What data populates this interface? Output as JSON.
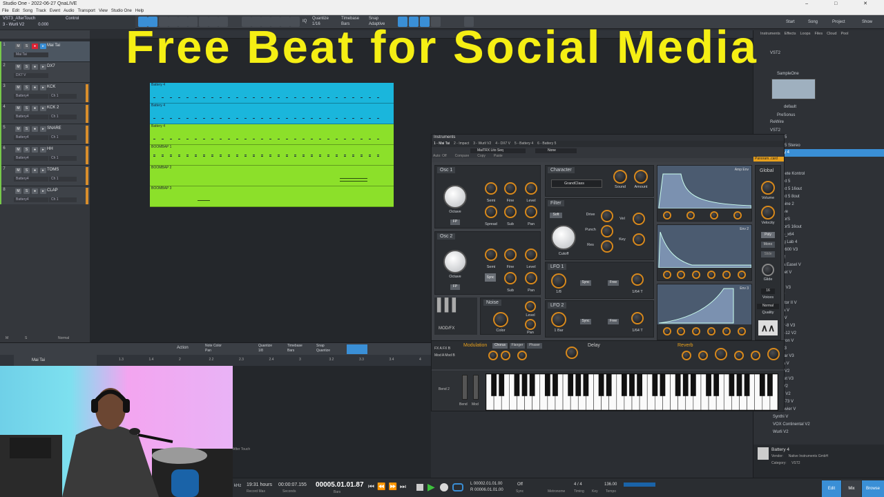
{
  "window": {
    "title": "Studio One - 2022-06-27 QnaLIVE",
    "controls": "–  □  ✕"
  },
  "menu": [
    "File",
    "Edit",
    "Song",
    "Track",
    "Event",
    "Audio",
    "Transport",
    "View",
    "Studio One",
    "Help"
  ],
  "song": {
    "name": "VST3_AfterTouch",
    "track": "3 - Wurli V2",
    "value": "0.000",
    "control_label": "Control"
  },
  "toolbar": {
    "quantize_label": "Quantize",
    "quantize": "1/16",
    "timebase_label": "Timebase",
    "timebase": "Bars",
    "snap_label": "Snap",
    "snap": "Adaptive",
    "iq": "IQ"
  },
  "right_nav": {
    "start": "Start",
    "song": "Song",
    "project": "Project",
    "show": "Show"
  },
  "ruler": [
    "9",
    "10"
  ],
  "overlay_title": "Free Beat for Social Media",
  "tracks": [
    {
      "num": "1",
      "name": "Mai Tai",
      "sel": "Mai Tai",
      "sel2": ""
    },
    {
      "num": "2",
      "name": "DX7",
      "sel": "DX7 V",
      "sel2": ""
    },
    {
      "num": "3",
      "name": "KCK",
      "sel": "Battery4",
      "sel2": "Ch 1"
    },
    {
      "num": "4",
      "name": "KCK 2",
      "sel": "Battery4",
      "sel2": "Ch 1"
    },
    {
      "num": "5",
      "name": "SNARE",
      "sel": "Battery4",
      "sel2": "Ch 1"
    },
    {
      "num": "6",
      "name": "HH",
      "sel": "Battery4",
      "sel2": "Ch 1"
    },
    {
      "num": "7",
      "name": "TOMS",
      "sel": "Battery4",
      "sel2": "Ch 1"
    },
    {
      "num": "8",
      "name": "CLAP",
      "sel": "Battery4",
      "sel2": "Ch 1"
    }
  ],
  "clips": [
    {
      "label": "Battery 4",
      "color": "blue"
    },
    {
      "label": "Battery 4",
      "color": "blue"
    },
    {
      "label": "Battery 4",
      "color": "green"
    },
    {
      "label": "BOOMBAP 1",
      "color": "green"
    },
    {
      "label": "BOOMBAP 2",
      "color": "green"
    },
    {
      "label": "BOOMBAP 3",
      "color": "green"
    }
  ],
  "browser": {
    "tabs": [
      "Instruments",
      "Effects",
      "Loops",
      "Files",
      "Cloud",
      "Pool"
    ],
    "items": [
      "VST2",
      "SampleOne",
      "default",
      "PreSonus",
      "ReWire",
      "VST2",
      "Synth 5",
      "Synth 5 Stereo",
      "Battery 4",
      "D2",
      "B3",
      "Complete Kontrol",
      "Kontakt 5",
      "Kontakt 5 16out",
      "Kontakt 5 8out",
      "Maschine 2",
      "Massive",
      "ReaktorS",
      "ReaktorS 16out",
      "Serum_x64",
      "Analog Lab 4",
      "ARP 2600 V3",
      "B-3 V2",
      "Buchla Easel V",
      "Clavinet V",
      "CMI V",
      "CS-80 V3",
      "DX7 V",
      "Emulator II V",
      "Farfisa V",
      "Jun-6 V",
      "Jupiter-8 V3",
      "Matrix-12 V2",
      "Mellotron V",
      "Mini V3",
      "Modular V3",
      "OB-Xa V",
      "Piano V2",
      "Prophet V3",
      "SEM V2",
      "Solina V2",
      "Stage-73 V",
      "Synclavier V",
      "Synthi V",
      "VOX Continental V2",
      "Wurli V2"
    ],
    "selected": "Battery 4",
    "footer": {
      "name": "Battery 4",
      "vendor_label": "Vendor:",
      "vendor": "Native Instruments GmbH",
      "cat_label": "Category:",
      "cat": "VST2"
    }
  },
  "instrument": {
    "title": "Instruments",
    "tabs": [
      "1 - Mai Tai",
      "2 - Impact",
      "3 - Wurli V2",
      "4 - DX7 V",
      "5 - Battery 4",
      "6 - Battery 5"
    ],
    "preset": "MaiTRX Lito Seq",
    "none": "None",
    "preset_right": "Panoram..card",
    "sub": [
      "Auto: Off",
      "Compare",
      "Copy",
      "Paste"
    ],
    "osc1": "Osc 1",
    "osc2": "Osc 2",
    "character": "Character",
    "filter": "Filter",
    "lfo1": "LFO 1",
    "lfo2": "LFO 2",
    "noise": "Noise",
    "global": "Global",
    "grandclass": "GrandClass",
    "knobs": {
      "octave": "Octave",
      "semi": "Semi",
      "fine": "Fine",
      "level": "Level",
      "spread": "Spread",
      "sub": "Sub",
      "pan": "Pan",
      "sound": "Sound",
      "amount": "Amount",
      "drive": "Drive",
      "punch": "Punch",
      "res": "Res",
      "cutoff": "Cutoff",
      "vel": "Vel",
      "key": "Key",
      "color": "Color",
      "volume": "Volume",
      "velocity": "Velocity",
      "glide": "Glide",
      "voices": "Voices",
      "quality": "Quality"
    },
    "fp": "FP",
    "sync": "Sync",
    "soft": "Soft",
    "free": "Free",
    "rate1": "1/8",
    "rate1r": "1/64 T",
    "rate2": "1 Bar",
    "rate2r": "1/64 T",
    "env": [
      "Amp Env",
      "Env 2",
      "Env 3"
    ],
    "poly": "Poly",
    "mono": "Mono",
    "legato": "Slide",
    "voices_val": "16",
    "quality_val": "Normal",
    "modfx": "MOD/FX",
    "modulation": "Modulation",
    "chorus": "Chorus",
    "flanger": "Flanger",
    "phaser": "Phaser",
    "delay": "Delay",
    "reverb": "Reverb",
    "mod_knobs": [
      "Mono",
      "Delay",
      "Speed",
      "Width",
      "Depth"
    ],
    "rev_knobs": [
      "Pre",
      "Damp",
      "Size",
      "Low",
      "High",
      "Mix"
    ],
    "bend": "Bend",
    "mod": "Mod",
    "bend2": "Bend 2"
  },
  "editor": {
    "track": "Mai Tai",
    "action": "Action",
    "note_color_label": "Note Color",
    "note_color": "Pan",
    "quantize_label": "Quantize",
    "quantize": "1/8",
    "timebase_label": "Timebase",
    "timebase": "Bars",
    "snap_label": "Snap",
    "snap": "Quantize",
    "ruler": [
      "1.3",
      "1.4",
      "2",
      "2.2",
      "2.3",
      "2.4",
      "3",
      "3.2",
      "3.3",
      "3.4",
      "4"
    ],
    "normal": "Normal"
  },
  "transport": {
    "rate": "kHz",
    "record_hours": "19:31 hours",
    "record_label": "Record Max",
    "seconds_val": "00:00:07.155",
    "seconds_label": "Seconds",
    "bars_val": "00005.01.01.87",
    "bars_label": "Bars",
    "l": "00002.01.01.00",
    "r": "00006.01.01.00",
    "sync": "Sync",
    "off": "Off",
    "metronome": "Metronome",
    "timing": "Timing",
    "sig": "4 / 4",
    "key": "Key",
    "tempo": "136.00",
    "tempo_label": "Tempo",
    "aftertouch": "After Touch"
  },
  "bottom_nav": {
    "edit": "Edit",
    "mix": "Mix",
    "browse": "Browse"
  },
  "colors": {
    "blue_clip": "#1ab6dc",
    "green_clip": "#8ce02a",
    "accent": "#3a8fd6",
    "knob": "#d8891c",
    "overlay": "#f5ef14"
  }
}
